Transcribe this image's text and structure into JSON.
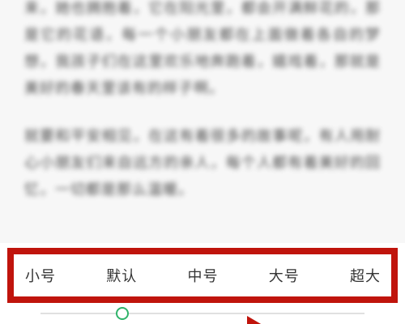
{
  "article": {
    "paragraphs": [
      "来，她也拥抱着，它在阳光里，都会开满鲜花的，那是它的花语，每一个小朋友都在上面做着各自的梦想，我孩子们在这里欢乐地奔跑着，嬉戏着，那就是美好的春天里该有的样子啊。",
      "就要和平安相见，在这有着很多的故事呢，有人用耐心小朋友们来自远方的亲人，每个人都有着美好的回忆，一切都是那么温暖。"
    ]
  },
  "font_size_panel": {
    "options": [
      "小号",
      "默认",
      "中号",
      "大号",
      "超大"
    ],
    "selected": "默认",
    "selected_index": 1,
    "accent_color": "#2fb36a",
    "highlight_color": "#c0140c"
  }
}
